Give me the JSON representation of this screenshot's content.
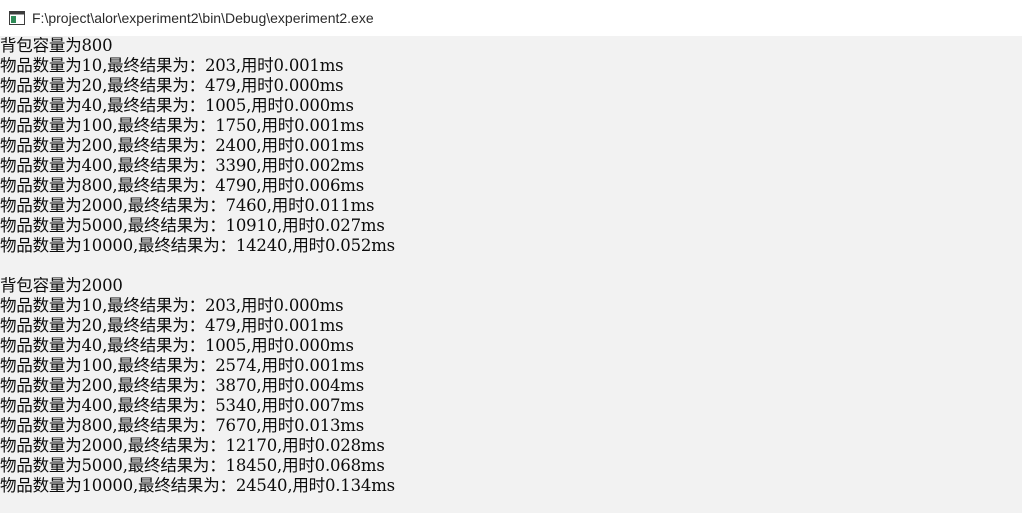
{
  "window": {
    "title": "F:\\project\\alor\\experiment2\\bin\\Debug\\experiment2.exe",
    "icon": "console-app-icon"
  },
  "console": {
    "blocks": [
      {
        "header": "背包容量为800",
        "lines": [
          "物品数量为10,最终结果为：203,用时0.001ms",
          "物品数量为20,最终结果为：479,用时0.000ms",
          "物品数量为40,最终结果为：1005,用时0.000ms",
          "物品数量为100,最终结果为：1750,用时0.001ms",
          "物品数量为200,最终结果为：2400,用时0.001ms",
          "物品数量为400,最终结果为：3390,用时0.002ms",
          "物品数量为800,最终结果为：4790,用时0.006ms",
          "物品数量为2000,最终结果为：7460,用时0.011ms",
          "物品数量为5000,最终结果为：10910,用时0.027ms",
          "物品数量为10000,最终结果为：14240,用时0.052ms"
        ]
      },
      {
        "header": "背包容量为2000",
        "lines": [
          "物品数量为10,最终结果为：203,用时0.000ms",
          "物品数量为20,最终结果为：479,用时0.001ms",
          "物品数量为40,最终结果为：1005,用时0.000ms",
          "物品数量为100,最终结果为：2574,用时0.001ms",
          "物品数量为200,最终结果为：3870,用时0.004ms",
          "物品数量为400,最终结果为：5340,用时0.007ms",
          "物品数量为800,最终结果为：7670,用时0.013ms",
          "物品数量为2000,最终结果为：12170,用时0.028ms",
          "物品数量为5000,最终结果为：18450,用时0.068ms",
          "物品数量为10000,最终结果为：24540,用时0.134ms"
        ]
      }
    ]
  }
}
